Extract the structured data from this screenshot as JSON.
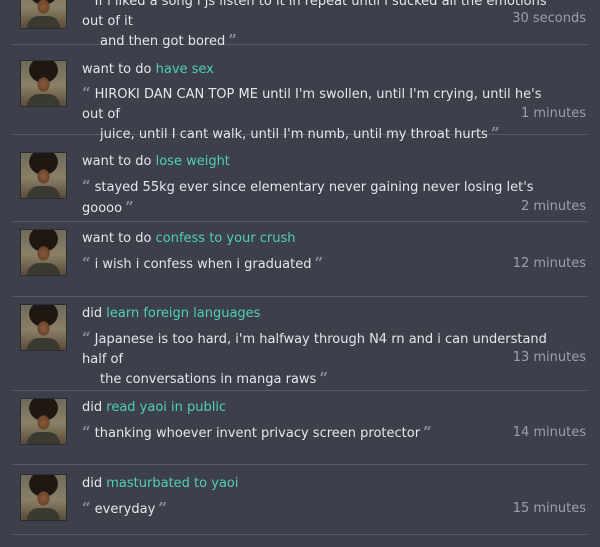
{
  "entries": [
    {
      "line1": "If i liked a song i js listen to it in repeat until i sucked all the emotions out of it",
      "line2": "and then got bored",
      "time": "30 seconds"
    },
    {
      "verb": "want to do",
      "goal": "have sex",
      "line1": "HIROKI DAN CAN TOP ME until I'm swollen, until I'm crying, until he's out of",
      "line2": "juice, until I cant walk, until I'm numb, until my throat hurts",
      "time": "1 minutes"
    },
    {
      "verb": "want to do",
      "goal": "lose weight",
      "line1": "stayed 55kg ever since elementary never gaining never losing let's goooo",
      "time": "2 minutes"
    },
    {
      "verb": "want to do",
      "goal": "confess to your crush",
      "line1": "i wish i confess when i graduated",
      "time": "12 minutes"
    },
    {
      "verb": "did",
      "goal": "learn foreign languages",
      "line1": "Japanese is too hard, i'm halfway through N4 rn and i can understand half of",
      "line2": "the conversations in manga raws",
      "time": "13 minutes"
    },
    {
      "verb": "did",
      "goal": "read yaoi in public",
      "line1": "thanking whoever invent privacy screen protector",
      "time": "14 minutes"
    },
    {
      "verb": "did",
      "goal": "masturbated to yaoi",
      "line1": "everyday",
      "time": "15 minutes"
    }
  ],
  "quote_open_glyph": "“",
  "quote_close_glyph": "”"
}
